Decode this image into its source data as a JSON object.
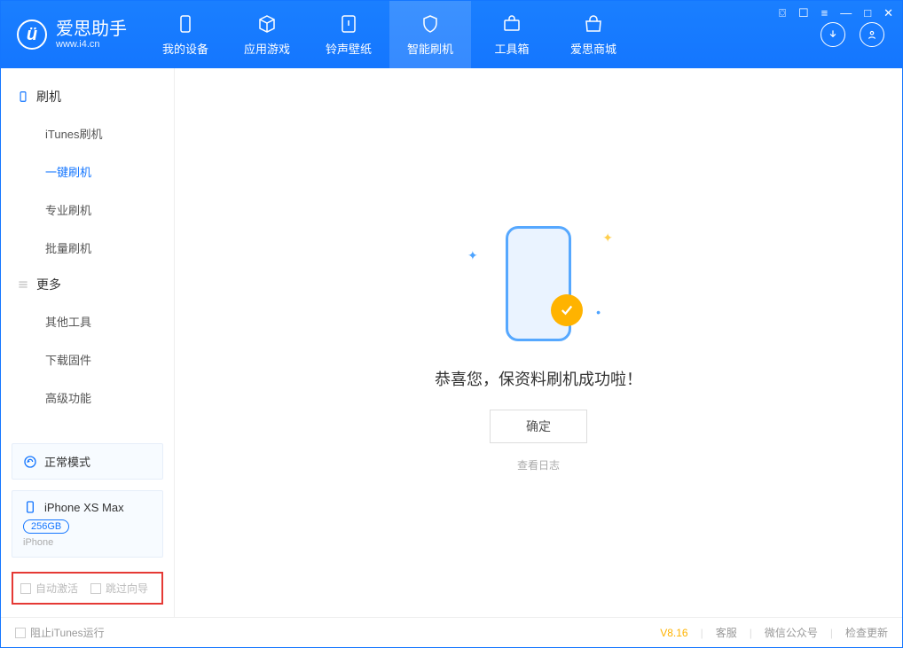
{
  "app": {
    "name_cn": "爱思助手",
    "url": "www.i4.cn"
  },
  "tabs": {
    "device": "我的设备",
    "apps": "应用游戏",
    "ring": "铃声壁纸",
    "flash": "智能刷机",
    "tools": "工具箱",
    "store": "爱思商城"
  },
  "sidebar": {
    "group1_title": "刷机",
    "g1": {
      "itunes": "iTunes刷机",
      "oneclick": "一键刷机",
      "pro": "专业刷机",
      "batch": "批量刷机"
    },
    "group2_title": "更多",
    "g2": {
      "other": "其他工具",
      "firmware": "下载固件",
      "advanced": "高级功能"
    }
  },
  "mode": {
    "label": "正常模式"
  },
  "device": {
    "name": "iPhone XS Max",
    "capacity": "256GB",
    "type": "iPhone"
  },
  "checks": {
    "auto_activate": "自动激活",
    "skip_guide": "跳过向导"
  },
  "main": {
    "success_msg": "恭喜您，保资料刷机成功啦！",
    "ok": "确定",
    "view_log": "查看日志"
  },
  "status": {
    "block_itunes": "阻止iTunes运行",
    "version": "V8.16",
    "support": "客服",
    "wechat": "微信公众号",
    "update": "检查更新"
  }
}
